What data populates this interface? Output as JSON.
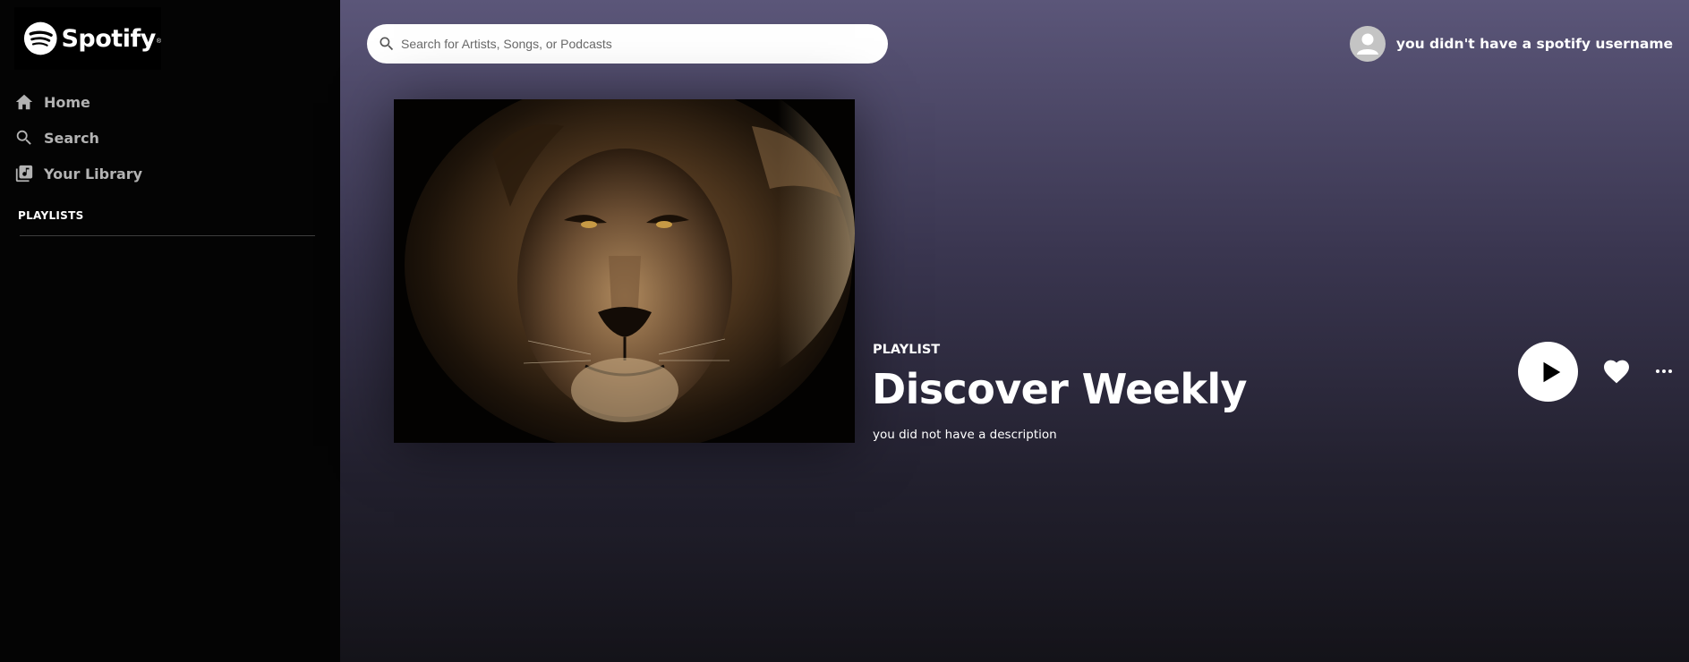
{
  "sidebar": {
    "logo_text": "Spotify",
    "nav": [
      {
        "label": "Home",
        "icon": "home-icon"
      },
      {
        "label": "Search",
        "icon": "search-icon"
      },
      {
        "label": "Your Library",
        "icon": "library-icon"
      }
    ],
    "playlists_heading": "PLAYLISTS"
  },
  "header": {
    "search_placeholder": "Search for Artists, Songs, or Podcasts",
    "search_value": "",
    "username": "you didn't have a spotify username"
  },
  "playlist": {
    "type": "PLAYLIST",
    "title": "Discover Weekly",
    "description": "you did not have a description",
    "cover_image": "lion-portrait"
  },
  "colors": {
    "sidebar_bg": "#040404",
    "main_gradient_top": "#5b5679",
    "main_gradient_bottom": "#141319",
    "nav_text": "#b3b3b3"
  }
}
